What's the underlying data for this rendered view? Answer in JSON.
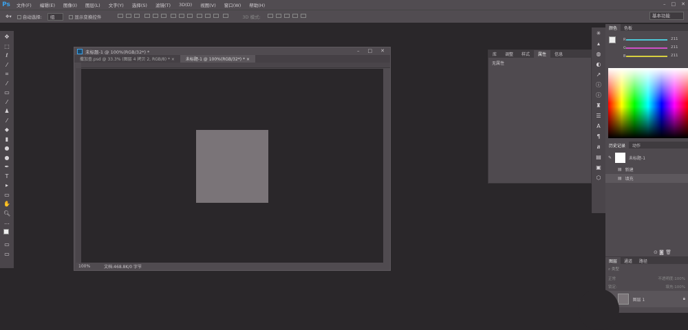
{
  "app": {
    "logo": "Ps",
    "menu": [
      "文件(F)",
      "编辑(E)",
      "图像(I)",
      "图层(L)",
      "文字(Y)",
      "选择(S)",
      "滤镜(T)",
      "3D(D)",
      "视图(V)",
      "窗口(W)",
      "帮助(H)"
    ],
    "window_controls": [
      "–",
      "□",
      "✕"
    ]
  },
  "options": {
    "auto_select_label": "自动选择:",
    "auto_select_value": "组",
    "show_transform_label": "显示变换控件",
    "mode_3d_label": "3D 模式:",
    "workspace": "基本功能"
  },
  "document": {
    "title": "未标题-1 @ 100%(RGB/32*) *",
    "tabs": [
      {
        "label": "撒加查.psd @ 33.3% (图层 4 拷贝 2, RGB/8) *",
        "close": "×"
      },
      {
        "label": "未标题-1 @ 100%(RGB/32*) *",
        "close": "×"
      }
    ],
    "zoom": "100%",
    "doc_info": "文档:468.8K/0 字节",
    "shape_color": "#7a7478"
  },
  "properties_panel": {
    "tabs": [
      "库",
      "调整",
      "样式",
      "属性",
      "信息"
    ],
    "active_tab": "属性",
    "content": "无属性"
  },
  "color_panel": {
    "tabs": [
      "颜色",
      "色板"
    ],
    "channels": [
      {
        "label": "R",
        "value": "211",
        "color": "#4ec8d8"
      },
      {
        "label": "G",
        "value": "211",
        "color": "#d050c8"
      },
      {
        "label": "B",
        "value": "211",
        "color": "#d8d040"
      }
    ]
  },
  "history_panel": {
    "tabs": [
      "历史记录",
      "动作"
    ],
    "snapshot": "未标题-1",
    "items": [
      "新建",
      "填充"
    ]
  },
  "layers_panel": {
    "tabs": [
      "图层",
      "通道",
      "路径"
    ],
    "kind": "类型",
    "blend": "正常",
    "opacity_label": "不透明度:",
    "opacity": "100%",
    "lock_label": "锁定:",
    "fill_label": "填充:",
    "fill": "100%",
    "layer_name": "图层 1"
  }
}
